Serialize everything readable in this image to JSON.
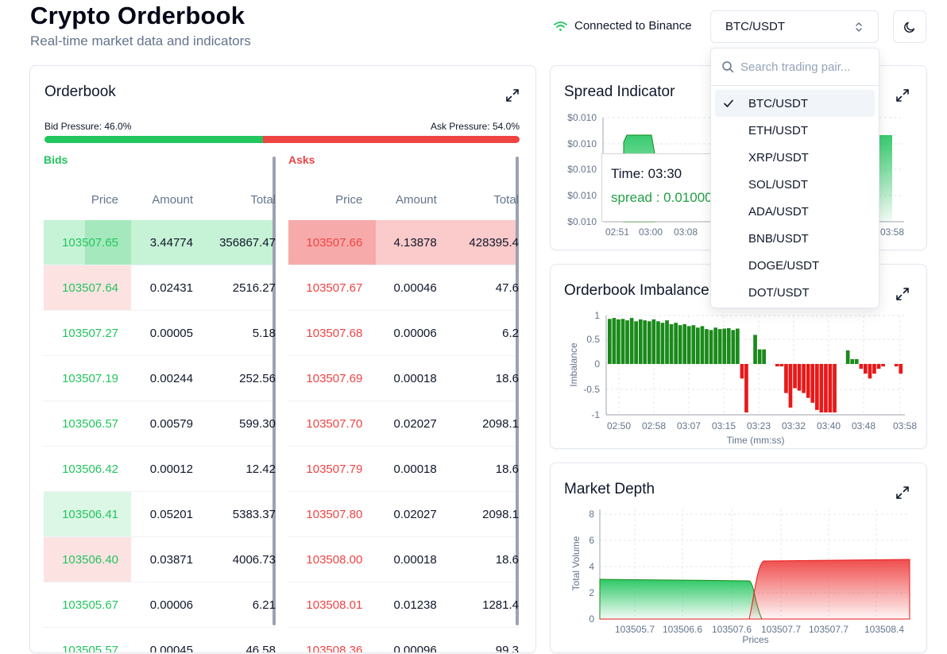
{
  "header": {
    "title": "Crypto Orderbook",
    "subtitle": "Real-time market data and indicators",
    "connection": "Connected to Binance",
    "selected_pair": "BTC/USDT"
  },
  "colors": {
    "bid": "#22c55e",
    "ask": "#ef4444",
    "bid_chart": "#1a8a1a",
    "ask_chart": "#e81919"
  },
  "orderbook": {
    "title": "Orderbook",
    "bid_pressure": "Bid Pressure: 46.0%",
    "ask_pressure": "Ask Pressure: 54.0%",
    "bid_pressure_value": 0.46,
    "bids_label": "Bids",
    "asks_label": "Asks",
    "columns": [
      "Price",
      "Amount",
      "Total"
    ],
    "bids": [
      {
        "price": "103507.65",
        "amount": "3.44774",
        "total": "356867.47"
      },
      {
        "price": "103507.64",
        "amount": "0.02431",
        "total": "2516.27"
      },
      {
        "price": "103507.27",
        "amount": "0.00005",
        "total": "5.18"
      },
      {
        "price": "103507.19",
        "amount": "0.00244",
        "total": "252.56"
      },
      {
        "price": "103506.57",
        "amount": "0.00579",
        "total": "599.30"
      },
      {
        "price": "103506.42",
        "amount": "0.00012",
        "total": "12.42"
      },
      {
        "price": "103506.41",
        "amount": "0.05201",
        "total": "5383.37"
      },
      {
        "price": "103506.40",
        "amount": "0.03871",
        "total": "4006.73"
      },
      {
        "price": "103505.67",
        "amount": "0.00006",
        "total": "6.21"
      },
      {
        "price": "103505.57",
        "amount": "0.00045",
        "total": "46.58"
      }
    ],
    "asks": [
      {
        "price": "103507.66",
        "amount": "4.13878",
        "total": "428395.4"
      },
      {
        "price": "103507.67",
        "amount": "0.00046",
        "total": "47.6"
      },
      {
        "price": "103507.68",
        "amount": "0.00006",
        "total": "6.2"
      },
      {
        "price": "103507.69",
        "amount": "0.00018",
        "total": "18.6"
      },
      {
        "price": "103507.70",
        "amount": "0.02027",
        "total": "2098.1"
      },
      {
        "price": "103507.79",
        "amount": "0.00018",
        "total": "18.6"
      },
      {
        "price": "103507.80",
        "amount": "0.02027",
        "total": "2098.1"
      },
      {
        "price": "103508.00",
        "amount": "0.00018",
        "total": "18.6"
      },
      {
        "price": "103508.01",
        "amount": "0.01238",
        "total": "1281.4"
      },
      {
        "price": "103508.36",
        "amount": "0.00096",
        "total": "99.3"
      }
    ]
  },
  "dropdown": {
    "placeholder": "Search trading pair...",
    "options": [
      "BTC/USDT",
      "ETH/USDT",
      "XRP/USDT",
      "SOL/USDT",
      "ADA/USDT",
      "BNB/USDT",
      "DOGE/USDT",
      "DOT/USDT"
    ],
    "selected": "BTC/USDT"
  },
  "chart_data": [
    {
      "type": "area",
      "title": "Spread Indicator",
      "x_ticks": [
        "02:51",
        "03:00",
        "03:08",
        "03:58"
      ],
      "y_ticks": [
        "$0.010",
        "$0.010",
        "$0.010",
        "$0.010",
        "$0.010"
      ],
      "tooltip": {
        "time": "Time: 03:30",
        "spread": "spread : 0.01000"
      }
    },
    {
      "type": "bar",
      "title": "Orderbook Imbalance",
      "xlabel": "Time (mm:ss)",
      "ylabel": "Imbalance",
      "ylim": [
        -1,
        1
      ],
      "y_ticks": [
        "1",
        "0.5",
        "0",
        "-0.5",
        "-1"
      ],
      "x_ticks": [
        "02:50",
        "02:58",
        "03:07",
        "03:15",
        "03:23",
        "03:32",
        "03:40",
        "03:48",
        "03:58"
      ],
      "values": [
        0.93,
        0.95,
        0.92,
        0.93,
        0.9,
        0.95,
        0.88,
        0.92,
        0.9,
        0.88,
        0.92,
        0.88,
        0.85,
        0.9,
        0.82,
        0.85,
        0.8,
        0.82,
        0.78,
        0.8,
        0.75,
        0.78,
        0.72,
        0.7,
        0.75,
        0.72,
        0.73,
        0.74,
        0.7,
        0.73,
        -0.3,
        -1,
        0,
        0.6,
        0.3,
        0.3,
        0,
        0,
        -0.05,
        -0.05,
        -0.6,
        -0.9,
        -0.5,
        -0.55,
        -0.6,
        -0.7,
        -0.8,
        -0.95,
        -1,
        -1,
        -1,
        -1,
        0,
        0,
        0.28,
        0.1,
        0.1,
        -0.1,
        -0.2,
        -0.3,
        -0.2,
        -0.1,
        -0.05,
        0,
        0,
        -0.05,
        -0.2
      ]
    },
    {
      "type": "area",
      "title": "Market Depth",
      "xlabel": "Prices",
      "ylabel": "Total Volume",
      "ylim": [
        0,
        8
      ],
      "y_ticks": [
        "0",
        "2",
        "4",
        "6",
        "8"
      ],
      "x_ticks": [
        "103505.7",
        "103506.6",
        "103507.6",
        "103507.7",
        "103507.7",
        "103508.4"
      ],
      "series": [
        {
          "name": "bids",
          "values": [
            2.75,
            2.7,
            2.65,
            0
          ]
        },
        {
          "name": "asks",
          "values": [
            0,
            4.15,
            4.2,
            4.2
          ]
        }
      ]
    }
  ]
}
